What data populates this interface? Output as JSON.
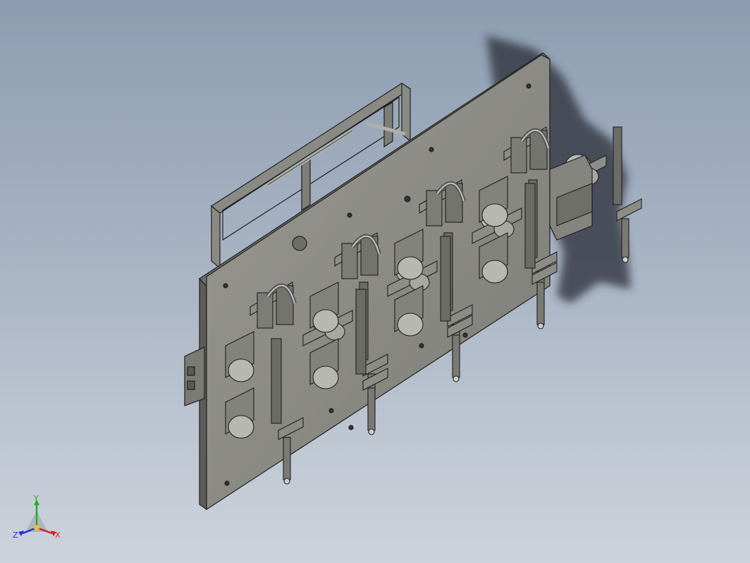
{
  "viewport": {
    "background_top": "#8d9db1",
    "background_bottom": "#cdd3dc",
    "model_fill": "#8a8a84",
    "model_edge": "#1f1f1f",
    "shadow": "#3a3d46"
  },
  "triad": {
    "x_label": "X",
    "y_label": "Y",
    "z_label": "Z",
    "x_color": "#d62020",
    "y_color": "#20b020",
    "z_color": "#2030d0"
  }
}
